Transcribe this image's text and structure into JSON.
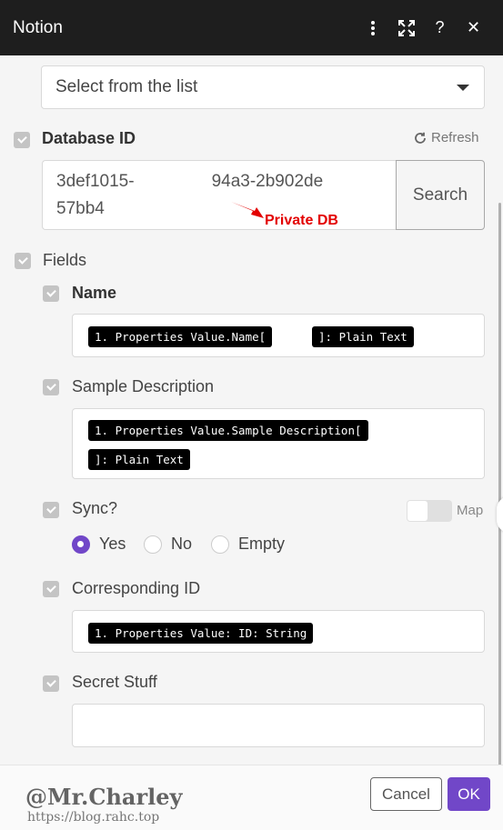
{
  "window": {
    "title": "Notion",
    "buttons": {
      "more_icon": "⋮",
      "expand_icon": "expand",
      "help": "?",
      "close": "✕"
    }
  },
  "select": {
    "placeholder": "Select from the list"
  },
  "database": {
    "label": "Database ID",
    "refresh": "Refresh",
    "value_line1_a": "3def1015-",
    "value_line1_b": "94a3-2b902de",
    "value_line2": "57bb4",
    "search_button": "Search",
    "annotation": "Private DB"
  },
  "fields": {
    "label": "Fields",
    "items": [
      {
        "label": "Name",
        "pills": [
          "1. Properties Value.Name[",
          "]: Plain Text"
        ]
      },
      {
        "label": "Sample Description",
        "pills": [
          "1. Properties Value.Sample Description[",
          "]: Plain Text"
        ]
      },
      {
        "label": "Sync?",
        "map_label": "Map",
        "options": [
          "Yes",
          "No",
          "Empty"
        ],
        "selected": "Yes"
      },
      {
        "label": "Corresponding ID",
        "pills": [
          "1. Properties Value: ID: String"
        ]
      },
      {
        "label": "Secret Stuff",
        "value": ""
      }
    ]
  },
  "footer": {
    "watermark": "@Mr.Charley",
    "watermark_url": "https://blog.rahc.top",
    "cancel": "Cancel",
    "ok": "OK"
  },
  "colors": {
    "accent": "#7147c8",
    "titlebar": "#1e1e1e",
    "annotation": "#e30000"
  }
}
